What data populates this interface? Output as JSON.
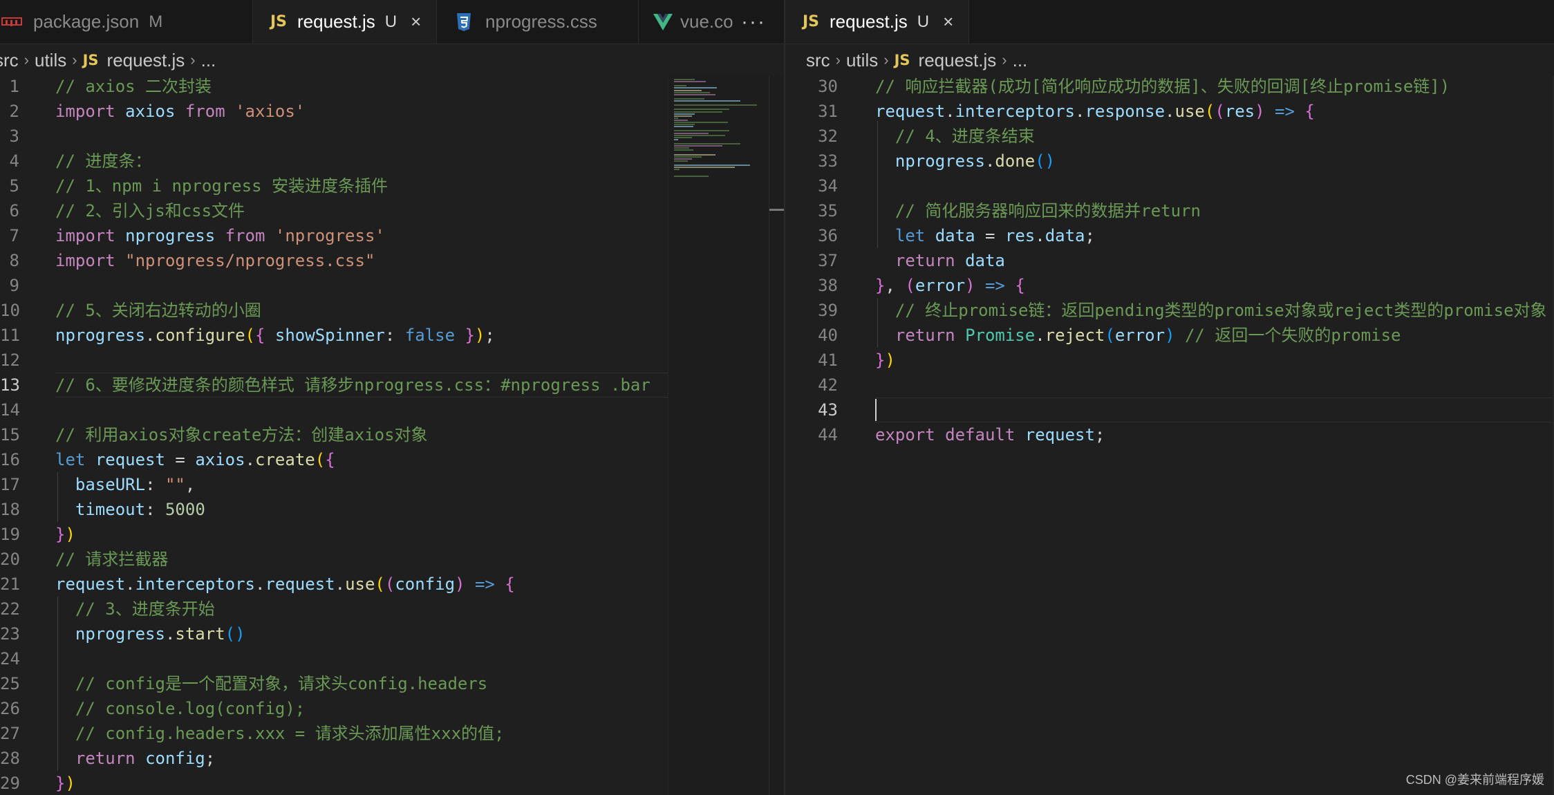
{
  "colors": {
    "comment": "#6a9955",
    "keyword": "#569cd6",
    "keyword_control": "#c586c0",
    "string": "#ce9178",
    "variable": "#9cdcfe",
    "function": "#dcdcaa",
    "number": "#b5cea8",
    "type": "#4ec9b0",
    "plain": "#d4d4d4",
    "bracket_gold": "#ffd700",
    "bracket_purple": "#da70d6",
    "bracket_blue": "#179fff"
  },
  "left_pane": {
    "tabs": [
      {
        "label": "package.json",
        "badge": "M",
        "icon": "npm-icon",
        "active": false
      },
      {
        "label": "request.js",
        "badge": "U",
        "icon": "js-icon",
        "active": true,
        "close": "×"
      },
      {
        "label": "nprogress.css",
        "badge": "",
        "icon": "css3-icon",
        "active": false
      },
      {
        "label": "vue.co",
        "badge": "",
        "icon": "vue-icon",
        "active": false
      }
    ],
    "more_label": "···",
    "breadcrumb": {
      "folder1": "src",
      "folder2": "utils",
      "js_label": "JS",
      "file": "request.js",
      "ellipsis": "..."
    },
    "current_line": 13,
    "lines": [
      {
        "n": 1,
        "t": [
          [
            "c",
            "// axios 二次封装"
          ]
        ]
      },
      {
        "n": 2,
        "t": [
          [
            "kc",
            "import"
          ],
          [
            "p",
            " "
          ],
          [
            "v",
            "axios"
          ],
          [
            "p",
            " "
          ],
          [
            "kc",
            "from"
          ],
          [
            "p",
            " "
          ],
          [
            "s",
            "'axios'"
          ]
        ]
      },
      {
        "n": 3,
        "t": []
      },
      {
        "n": 4,
        "t": [
          [
            "c",
            "// 进度条："
          ]
        ]
      },
      {
        "n": 5,
        "t": [
          [
            "c",
            "// 1、npm i nprogress 安装进度条插件"
          ]
        ]
      },
      {
        "n": 6,
        "t": [
          [
            "c",
            "// 2、引入js和css文件"
          ]
        ]
      },
      {
        "n": 7,
        "t": [
          [
            "kc",
            "import"
          ],
          [
            "p",
            " "
          ],
          [
            "v",
            "nprogress"
          ],
          [
            "p",
            " "
          ],
          [
            "kc",
            "from"
          ],
          [
            "p",
            " "
          ],
          [
            "s",
            "'nprogress'"
          ]
        ]
      },
      {
        "n": 8,
        "t": [
          [
            "kc",
            "import"
          ],
          [
            "p",
            " "
          ],
          [
            "s",
            "\"nprogress/nprogress.css\""
          ]
        ]
      },
      {
        "n": 9,
        "t": []
      },
      {
        "n": 10,
        "t": [
          [
            "c",
            "// 5、关闭右边转动的小圈"
          ]
        ]
      },
      {
        "n": 11,
        "t": [
          [
            "v",
            "nprogress"
          ],
          [
            "p",
            "."
          ],
          [
            "f",
            "configure"
          ],
          [
            "b1",
            "("
          ],
          [
            "b2",
            "{"
          ],
          [
            "p",
            " "
          ],
          [
            "v",
            "showSpinner"
          ],
          [
            "p",
            ": "
          ],
          [
            "k",
            "false"
          ],
          [
            "p",
            " "
          ],
          [
            "b2",
            "}"
          ],
          [
            "b1",
            ")"
          ],
          [
            "p",
            ";"
          ]
        ]
      },
      {
        "n": 12,
        "t": []
      },
      {
        "n": 13,
        "t": [
          [
            "c",
            "// 6、要修改进度条的颜色样式 请移步nprogress.css：#nprogress .bar"
          ]
        ]
      },
      {
        "n": 14,
        "t": []
      },
      {
        "n": 15,
        "t": [
          [
            "c",
            "// 利用axios对象create方法：创建axios对象"
          ]
        ]
      },
      {
        "n": 16,
        "t": [
          [
            "k",
            "let"
          ],
          [
            "p",
            " "
          ],
          [
            "v",
            "request"
          ],
          [
            "p",
            " = "
          ],
          [
            "v",
            "axios"
          ],
          [
            "p",
            "."
          ],
          [
            "f",
            "create"
          ],
          [
            "b1",
            "("
          ],
          [
            "b2",
            "{"
          ]
        ]
      },
      {
        "n": 17,
        "t": [
          [
            "p",
            "  "
          ],
          [
            "v",
            "baseURL"
          ],
          [
            "p",
            ": "
          ],
          [
            "s",
            "\"\""
          ],
          [
            "p",
            ","
          ]
        ]
      },
      {
        "n": 18,
        "t": [
          [
            "p",
            "  "
          ],
          [
            "v",
            "timeout"
          ],
          [
            "p",
            ": "
          ],
          [
            "num",
            "5000"
          ]
        ]
      },
      {
        "n": 19,
        "t": [
          [
            "b2",
            "}"
          ],
          [
            "b1",
            ")"
          ]
        ]
      },
      {
        "n": 20,
        "t": [
          [
            "c",
            "// 请求拦截器"
          ]
        ]
      },
      {
        "n": 21,
        "t": [
          [
            "v",
            "request"
          ],
          [
            "p",
            "."
          ],
          [
            "v",
            "interceptors"
          ],
          [
            "p",
            "."
          ],
          [
            "v",
            "request"
          ],
          [
            "p",
            "."
          ],
          [
            "f",
            "use"
          ],
          [
            "b1",
            "("
          ],
          [
            "b2",
            "("
          ],
          [
            "v",
            "config"
          ],
          [
            "b2",
            ")"
          ],
          [
            "p",
            " "
          ],
          [
            "k",
            "=>"
          ],
          [
            "p",
            " "
          ],
          [
            "b2",
            "{"
          ]
        ]
      },
      {
        "n": 22,
        "t": [
          [
            "p",
            "  "
          ],
          [
            "c",
            "// 3、进度条开始"
          ]
        ]
      },
      {
        "n": 23,
        "t": [
          [
            "p",
            "  "
          ],
          [
            "v",
            "nprogress"
          ],
          [
            "p",
            "."
          ],
          [
            "f",
            "start"
          ],
          [
            "b3",
            "()"
          ]
        ]
      },
      {
        "n": 24,
        "t": []
      },
      {
        "n": 25,
        "t": [
          [
            "p",
            "  "
          ],
          [
            "c",
            "// config是一个配置对象，请求头config.headers"
          ]
        ]
      },
      {
        "n": 26,
        "t": [
          [
            "p",
            "  "
          ],
          [
            "c",
            "// console.log(config);"
          ]
        ]
      },
      {
        "n": 27,
        "t": [
          [
            "p",
            "  "
          ],
          [
            "c",
            "// config.headers.xxx = 请求头添加属性xxx的值;"
          ]
        ]
      },
      {
        "n": 28,
        "t": [
          [
            "p",
            "  "
          ],
          [
            "kc",
            "return"
          ],
          [
            "p",
            " "
          ],
          [
            "v",
            "config"
          ],
          [
            "p",
            ";"
          ]
        ]
      },
      {
        "n": 29,
        "t": [
          [
            "b2",
            "}"
          ],
          [
            "b1",
            ")"
          ]
        ]
      }
    ]
  },
  "right_pane": {
    "tab": {
      "label": "request.js",
      "badge": "U",
      "icon": "js-icon",
      "close": "×"
    },
    "breadcrumb": {
      "folder1": "src",
      "folder2": "utils",
      "js_label": "JS",
      "file": "request.js",
      "ellipsis": "..."
    },
    "current_line": 43,
    "lines": [
      {
        "n": 30,
        "t": [
          [
            "c",
            "// 响应拦截器(成功[简化响应成功的数据]、失败的回调[终止promise链])"
          ]
        ]
      },
      {
        "n": 31,
        "t": [
          [
            "v",
            "request"
          ],
          [
            "p",
            "."
          ],
          [
            "v",
            "interceptors"
          ],
          [
            "p",
            "."
          ],
          [
            "v",
            "response"
          ],
          [
            "p",
            "."
          ],
          [
            "f",
            "use"
          ],
          [
            "b1",
            "("
          ],
          [
            "b2",
            "("
          ],
          [
            "v",
            "res"
          ],
          [
            "b2",
            ")"
          ],
          [
            "p",
            " "
          ],
          [
            "k",
            "=>"
          ],
          [
            "p",
            " "
          ],
          [
            "b2",
            "{"
          ]
        ]
      },
      {
        "n": 32,
        "t": [
          [
            "p",
            "  "
          ],
          [
            "c",
            "// 4、进度条结束"
          ]
        ]
      },
      {
        "n": 33,
        "t": [
          [
            "p",
            "  "
          ],
          [
            "v",
            "nprogress"
          ],
          [
            "p",
            "."
          ],
          [
            "f",
            "done"
          ],
          [
            "b3",
            "()"
          ]
        ]
      },
      {
        "n": 34,
        "t": []
      },
      {
        "n": 35,
        "t": [
          [
            "p",
            "  "
          ],
          [
            "c",
            "// 简化服务器响应回来的数据并return"
          ]
        ]
      },
      {
        "n": 36,
        "t": [
          [
            "p",
            "  "
          ],
          [
            "k",
            "let"
          ],
          [
            "p",
            " "
          ],
          [
            "v",
            "data"
          ],
          [
            "p",
            " = "
          ],
          [
            "v",
            "res"
          ],
          [
            "p",
            "."
          ],
          [
            "v",
            "data"
          ],
          [
            "p",
            ";"
          ]
        ]
      },
      {
        "n": 37,
        "t": [
          [
            "p",
            "  "
          ],
          [
            "kc",
            "return"
          ],
          [
            "p",
            " "
          ],
          [
            "v",
            "data"
          ]
        ]
      },
      {
        "n": 38,
        "t": [
          [
            "b2",
            "}"
          ],
          [
            "p",
            ", "
          ],
          [
            "b2",
            "("
          ],
          [
            "v",
            "error"
          ],
          [
            "b2",
            ")"
          ],
          [
            "p",
            " "
          ],
          [
            "k",
            "=>"
          ],
          [
            "p",
            " "
          ],
          [
            "b2",
            "{"
          ]
        ]
      },
      {
        "n": 39,
        "t": [
          [
            "p",
            "  "
          ],
          [
            "c",
            "// 终止promise链：返回pending类型的promise对象或reject类型的promise对象"
          ]
        ]
      },
      {
        "n": 40,
        "t": [
          [
            "p",
            "  "
          ],
          [
            "kc",
            "return"
          ],
          [
            "p",
            " "
          ],
          [
            "ty",
            "Promise"
          ],
          [
            "p",
            "."
          ],
          [
            "f",
            "reject"
          ],
          [
            "b3",
            "("
          ],
          [
            "v",
            "error"
          ],
          [
            "b3",
            ")"
          ],
          [
            "p",
            " "
          ],
          [
            "c",
            "// 返回一个失败的promise"
          ]
        ]
      },
      {
        "n": 41,
        "t": [
          [
            "b2",
            "}"
          ],
          [
            "b1",
            ")"
          ]
        ]
      },
      {
        "n": 42,
        "t": []
      },
      {
        "n": 43,
        "t": []
      },
      {
        "n": 44,
        "t": [
          [
            "kc",
            "export"
          ],
          [
            "p",
            " "
          ],
          [
            "kc",
            "default"
          ],
          [
            "p",
            " "
          ],
          [
            "v",
            "request"
          ],
          [
            "p",
            ";"
          ]
        ]
      }
    ]
  },
  "watermark": "CSDN @姜来前端程序媛"
}
